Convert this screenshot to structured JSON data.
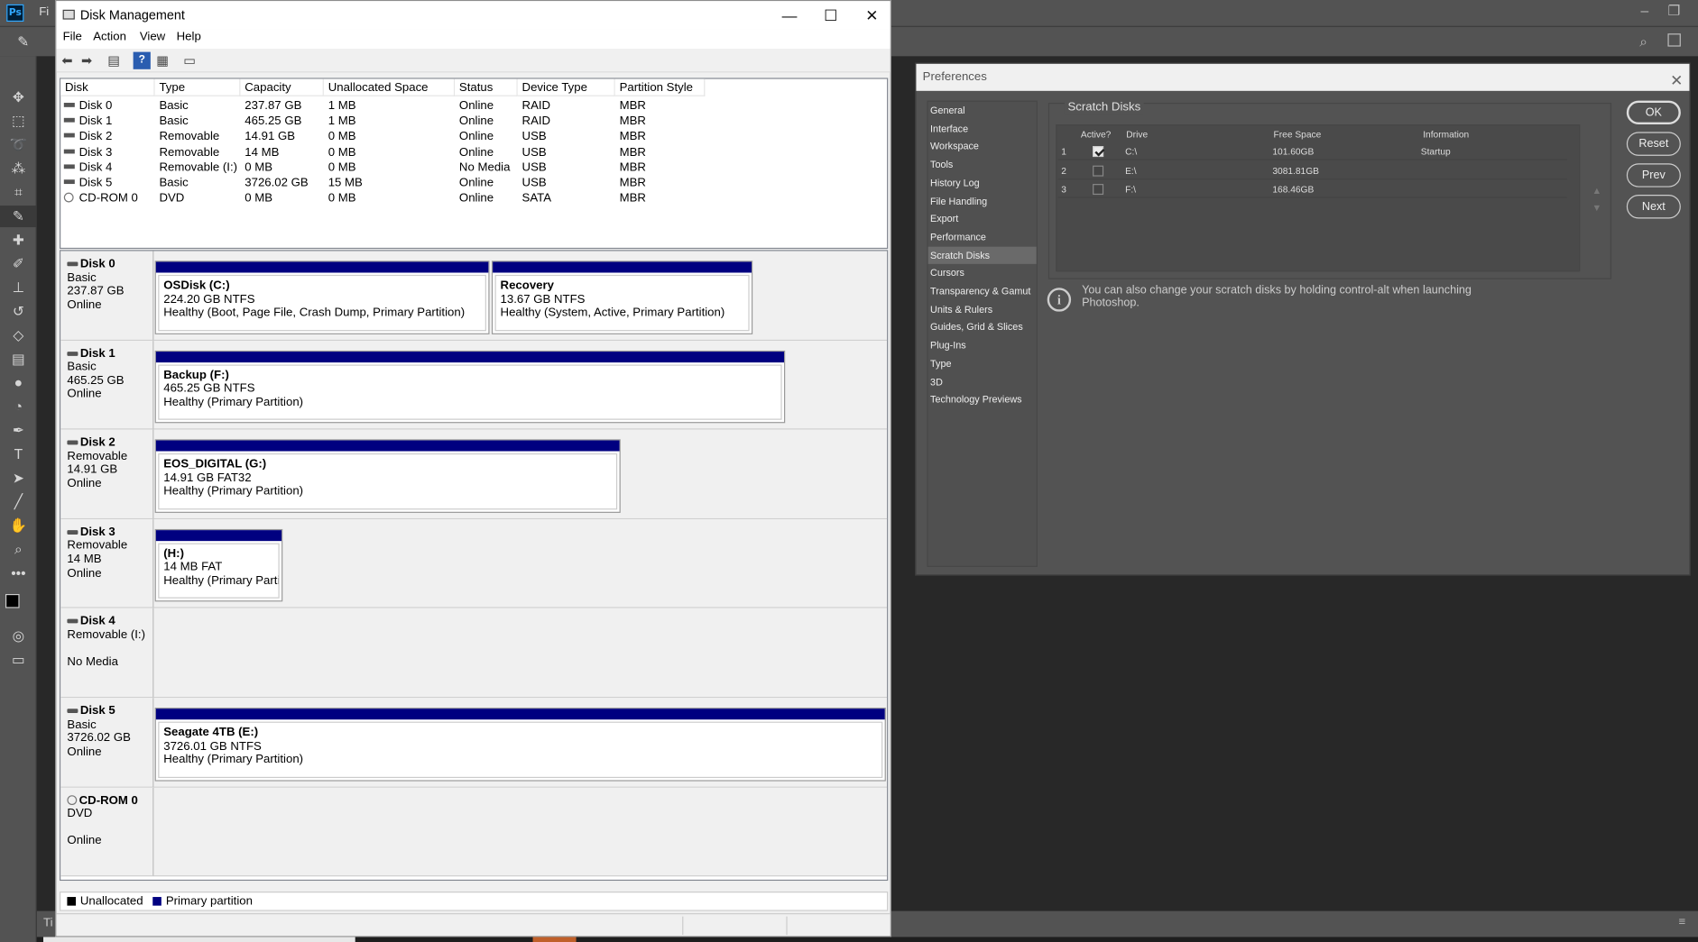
{
  "photoshop": {
    "logo": "Ps",
    "menu_fragment": "Fi",
    "status_fragment": "Ti"
  },
  "disk_mgmt": {
    "title": "Disk Management",
    "menu": [
      "File",
      "Action",
      "View",
      "Help"
    ],
    "columns": [
      "Disk",
      "Type",
      "Capacity",
      "Unallocated Space",
      "Status",
      "Device Type",
      "Partition Style"
    ],
    "rows": [
      [
        "Disk 0",
        "Basic",
        "237.87 GB",
        "1 MB",
        "Online",
        "RAID",
        "MBR"
      ],
      [
        "Disk 1",
        "Basic",
        "465.25 GB",
        "1 MB",
        "Online",
        "RAID",
        "MBR"
      ],
      [
        "Disk 2",
        "Removable",
        "14.91 GB",
        "0 MB",
        "Online",
        "USB",
        "MBR"
      ],
      [
        "Disk 3",
        "Removable",
        "14 MB",
        "0 MB",
        "Online",
        "USB",
        "MBR"
      ],
      [
        "Disk 4",
        "Removable (I:)",
        "0 MB",
        "0 MB",
        "No Media",
        "USB",
        "MBR"
      ],
      [
        "Disk 5",
        "Basic",
        "3726.02 GB",
        "15 MB",
        "Online",
        "USB",
        "MBR"
      ],
      [
        "CD-ROM 0",
        "DVD",
        "0 MB",
        "0 MB",
        "Online",
        "SATA",
        "MBR"
      ]
    ],
    "disks": [
      {
        "name": "Disk 0",
        "type": "Basic",
        "size": "237.87 GB",
        "status": "Online",
        "partitions": [
          {
            "name": "OSDisk  (C:)",
            "size": "224.20 GB NTFS",
            "health": "Healthy (Boot, Page File, Crash Dump, Primary Partition)"
          },
          {
            "name": "Recovery",
            "size": "13.67 GB NTFS",
            "health": "Healthy (System, Active, Primary Partition)"
          }
        ]
      },
      {
        "name": "Disk 1",
        "type": "Basic",
        "size": "465.25 GB",
        "status": "Online",
        "partitions": [
          {
            "name": "Backup  (F:)",
            "size": "465.25 GB NTFS",
            "health": "Healthy (Primary Partition)"
          }
        ]
      },
      {
        "name": "Disk 2",
        "type": "Removable",
        "size": "14.91 GB",
        "status": "Online",
        "partitions": [
          {
            "name": "EOS_DIGITAL  (G:)",
            "size": "14.91 GB FAT32",
            "health": "Healthy (Primary Partition)"
          }
        ]
      },
      {
        "name": "Disk 3",
        "type": "Removable",
        "size": "14 MB",
        "status": "Online",
        "partitions": [
          {
            "name": "(H:)",
            "size": "14 MB FAT",
            "health": "Healthy (Primary Partiti"
          }
        ]
      },
      {
        "name": "Disk 4",
        "type": "Removable (I:)",
        "size": "",
        "status": "No Media",
        "partitions": []
      },
      {
        "name": "Disk 5",
        "type": "Basic",
        "size": "3726.02 GB",
        "status": "Online",
        "partitions": [
          {
            "name": "Seagate 4TB  (E:)",
            "size": "3726.01 GB NTFS",
            "health": "Healthy (Primary Partition)"
          }
        ]
      },
      {
        "name": "CD-ROM 0",
        "type": "DVD",
        "size": "",
        "status": "Online",
        "partitions": []
      }
    ],
    "legend": {
      "unallocated": "Unallocated",
      "primary": "Primary partition",
      "unallocated_color": "#000000",
      "primary_color": "#000080"
    }
  },
  "preferences": {
    "title": "Preferences",
    "nav": [
      "General",
      "Interface",
      "Workspace",
      "Tools",
      "History Log",
      "File Handling",
      "Export",
      "Performance",
      "Scratch Disks",
      "Cursors",
      "Transparency & Gamut",
      "Units & Rulers",
      "Guides, Grid & Slices",
      "Plug-Ins",
      "Type",
      "3D",
      "Technology Previews"
    ],
    "selected_nav": "Scratch Disks",
    "group_title": "Scratch Disks",
    "headers": {
      "active": "Active?",
      "drive": "Drive",
      "free": "Free Space",
      "info": "Information"
    },
    "drives": [
      {
        "num": "1",
        "active": true,
        "drive": "C:\\",
        "free": "101.60GB",
        "info": "Startup"
      },
      {
        "num": "2",
        "active": false,
        "drive": "E:\\",
        "free": "3081.81GB",
        "info": ""
      },
      {
        "num": "3",
        "active": false,
        "drive": "F:\\",
        "free": "168.46GB",
        "info": ""
      }
    ],
    "info_text": "You can also change your scratch disks by holding control-alt when launching Photoshop.",
    "buttons": {
      "ok": "OK",
      "reset": "Reset",
      "prev": "Prev",
      "next": "Next"
    }
  }
}
